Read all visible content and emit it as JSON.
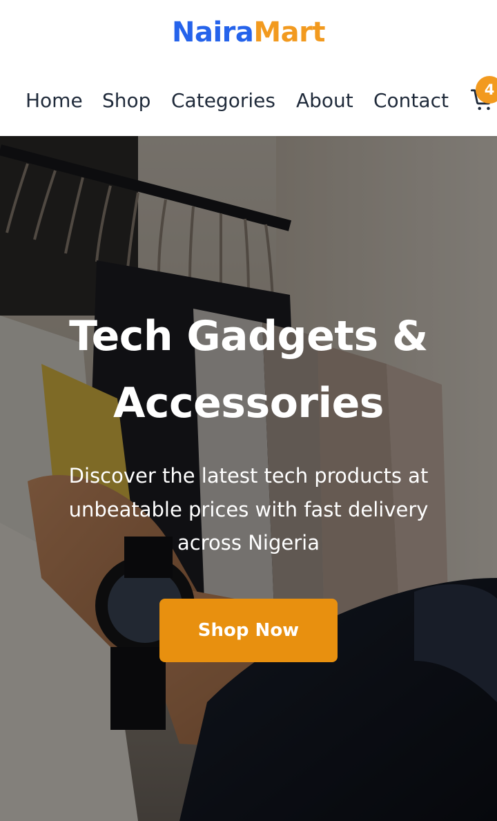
{
  "brand": {
    "part1": "Naira",
    "part2": "Mart"
  },
  "nav": {
    "items": [
      {
        "label": "Home"
      },
      {
        "label": "Shop"
      },
      {
        "label": "Categories"
      },
      {
        "label": "About"
      },
      {
        "label": "Contact"
      }
    ]
  },
  "cart": {
    "icon": "cart-icon",
    "count": "4"
  },
  "hero": {
    "title": "Tech Gadgets & Accessories",
    "subtitle": "Discover the latest tech products at unbeatable prices with fast delivery across Nigeria",
    "cta_label": "Shop Now",
    "background": "clothing rack with hand wearing wristwatch"
  },
  "colors": {
    "brand_blue": "#2563eb",
    "brand_orange": "#f29a1f",
    "cta_orange": "#e8900f",
    "nav_text": "#1f2a3a"
  }
}
